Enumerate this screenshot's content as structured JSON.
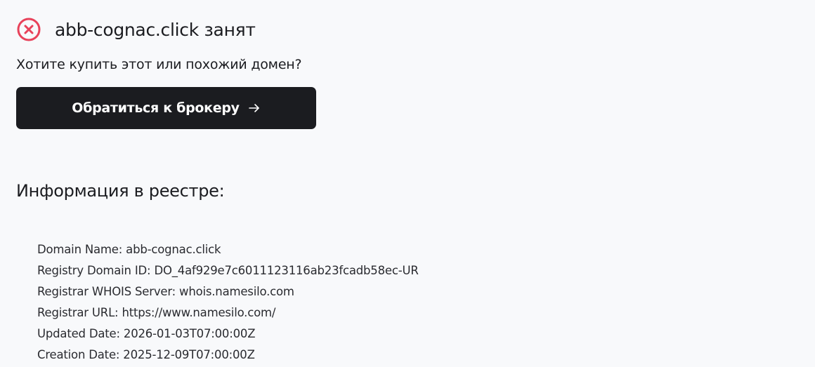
{
  "status": {
    "icon": "x-circle-icon",
    "icon_color": "#e8425a",
    "title": "abb-cognac.click занят"
  },
  "subtitle": "Хотите купить этот или похожий домен?",
  "broker_button": {
    "label": "Обратиться к брокеру",
    "icon": "arrow-right-icon"
  },
  "registry": {
    "heading": "Информация в реестре:",
    "lines": [
      "Domain Name: abb-cognac.click",
      "Registry Domain ID: DO_4af929e7c6011123116ab23fcadb58ec-UR",
      "Registrar WHOIS Server: whois.namesilo.com",
      "Registrar URL: https://www.namesilo.com/",
      "Updated Date: 2026-01-03T07:00:00Z",
      "Creation Date: 2025-12-09T07:00:00Z"
    ]
  },
  "colors": {
    "background": "#f8f9fb",
    "text": "#1b1c20",
    "button_bg": "#1b1c20",
    "button_text": "#ffffff",
    "error_red": "#e8425a"
  }
}
